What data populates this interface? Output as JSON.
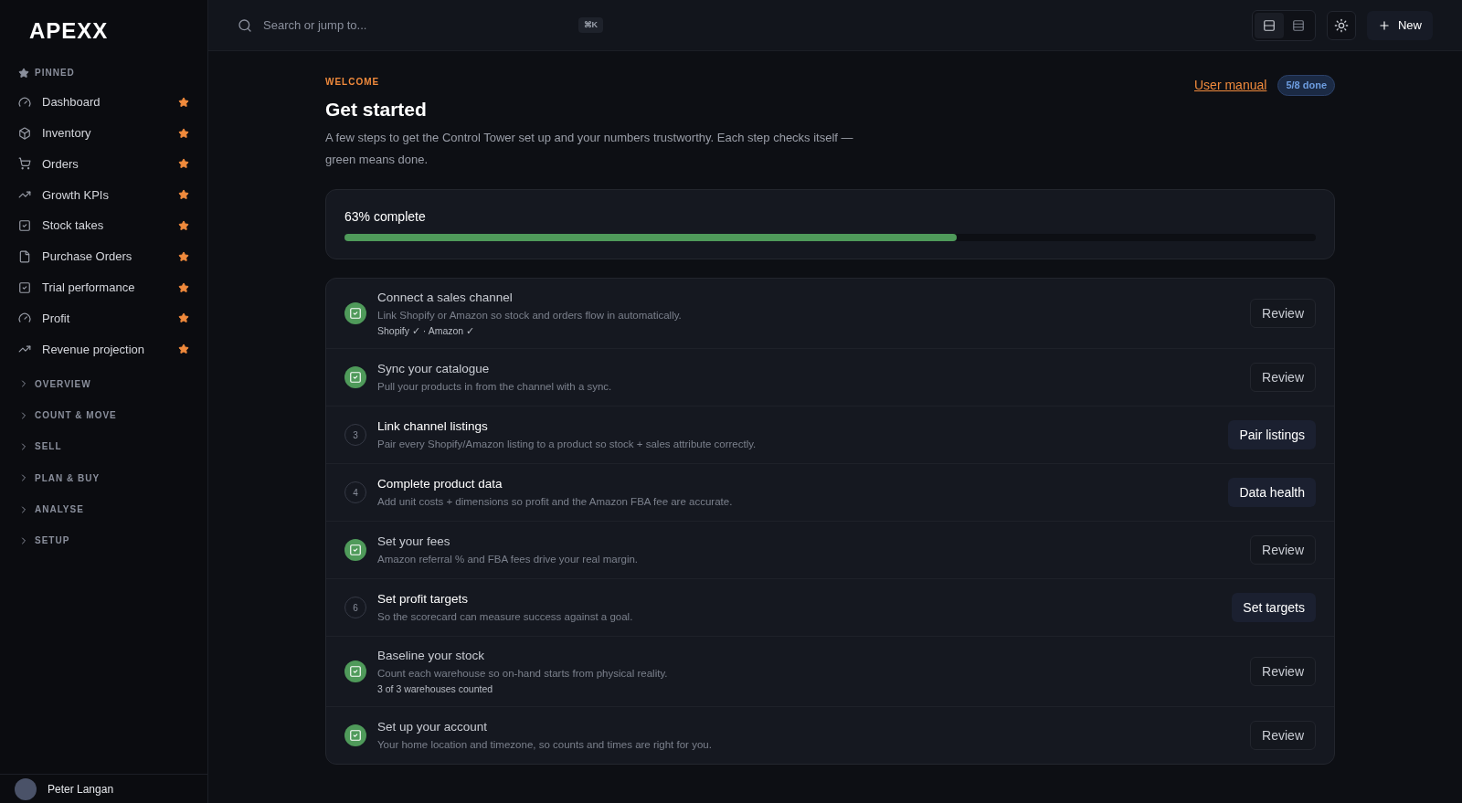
{
  "brand": "APEXX",
  "sidebar": {
    "pinned_label": "PINNED",
    "pinned": [
      {
        "label": "Dashboard",
        "kind": "gauge",
        "starred": true
      },
      {
        "label": "Inventory",
        "kind": "box",
        "starred": true
      },
      {
        "label": "Orders",
        "kind": "cart",
        "starred": true
      },
      {
        "label": "Growth KPIs",
        "kind": "trend",
        "starred": true
      },
      {
        "label": "Stock takes",
        "kind": "check",
        "starred": true
      },
      {
        "label": "Purchase Orders",
        "kind": "file",
        "starred": true
      },
      {
        "label": "Trial performance",
        "kind": "check",
        "starred": true
      },
      {
        "label": "Profit",
        "kind": "gauge",
        "starred": true
      },
      {
        "label": "Revenue projection",
        "kind": "trend",
        "starred": true
      }
    ],
    "sections": [
      {
        "label": "OVERVIEW",
        "expanded": false
      },
      {
        "label": "COUNT & MOVE",
        "expanded": false
      },
      {
        "label": "SELL",
        "expanded": false
      },
      {
        "label": "PLAN & BUY",
        "expanded": false
      },
      {
        "label": "ANALYSE",
        "expanded": false
      },
      {
        "label": "SETUP",
        "expanded": false
      }
    ],
    "user": "Peter Langan"
  },
  "topbar": {
    "search_placeholder": "Search or jump to...",
    "shortcut": "⌘K",
    "new_label": "New",
    "views": [
      {
        "selected": true
      },
      {
        "selected": false
      }
    ]
  },
  "header": {
    "eyebrow": "WELCOME",
    "title": "Get started",
    "description": "A few steps to get the Control Tower set up and your numbers trustworthy. Each step checks itself — green means done.",
    "manual_link": "User manual",
    "badge": "5/8 done"
  },
  "progress": {
    "label": "63% complete",
    "level": 0.63
  },
  "steps": [
    {
      "title": "Connect a sales channel",
      "description": "Link Shopify or Amazon so stock and orders flow in automatically.",
      "note": "Shopify ✓ · Amazon ✓",
      "done": true,
      "action": "Review"
    },
    {
      "title": "Sync your catalogue",
      "description": "Pull your products in from the channel with a sync.",
      "done": true,
      "action": "Review"
    },
    {
      "number": "3",
      "title": "Link channel listings",
      "description": "Pair every Shopify/Amazon listing to a product so stock + sales attribute correctly.",
      "done": false,
      "action": "Pair listings"
    },
    {
      "number": "4",
      "title": "Complete product data",
      "description": "Add unit costs + dimensions so profit and the Amazon FBA fee are accurate.",
      "done": false,
      "action": "Data health"
    },
    {
      "title": "Set your fees",
      "description": "Amazon referral % and FBA fees drive your real margin.",
      "done": true,
      "action": "Review"
    },
    {
      "number": "6",
      "title": "Set profit targets",
      "description": "So the scorecard can measure success against a goal.",
      "done": false,
      "action": "Set targets"
    },
    {
      "title": "Baseline your stock",
      "description": "Count each warehouse so on-hand starts from physical reality.",
      "note": "3 of 3 warehouses counted",
      "done": true,
      "action": "Review"
    },
    {
      "title": "Set up your account",
      "description": "Your home location and timezone, so counts and times are right for you.",
      "done": true,
      "action": "Review"
    }
  ]
}
